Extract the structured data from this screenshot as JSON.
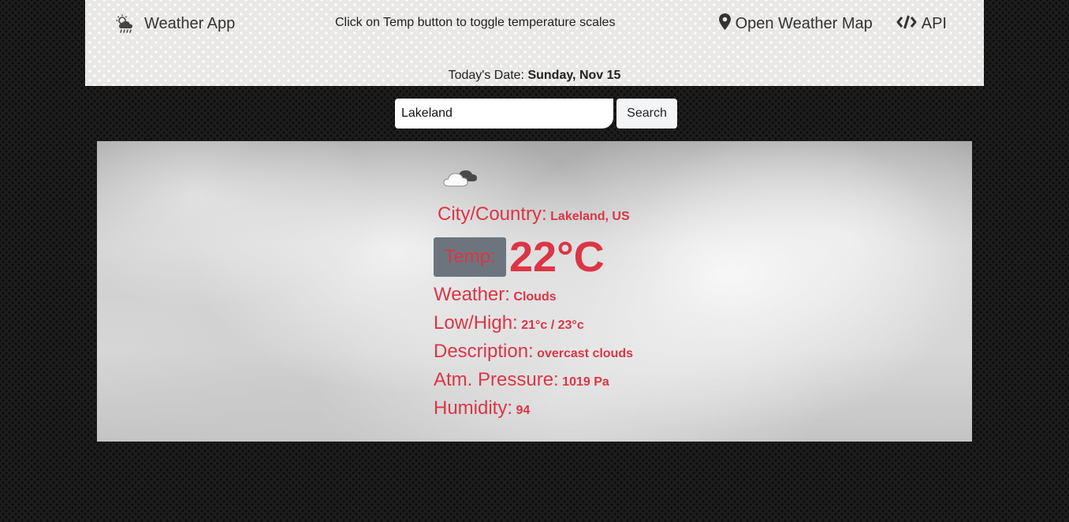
{
  "nav": {
    "brand": "Weather App",
    "brand_icon": "cloud-rain-icon",
    "hint": "Click on Temp button to toggle temperature scales",
    "links": [
      {
        "label": "Open Weather Map",
        "icon": "map-marker-icon"
      },
      {
        "label": "API",
        "icon": "code-icon"
      }
    ],
    "date_label": "Today's Date:",
    "date_value": "Sunday, Nov 15"
  },
  "search": {
    "value": "Lakeland",
    "button": "Search"
  },
  "weather": {
    "icon": "cloud-icon",
    "city_label": "City/Country:",
    "city_value": "Lakeland, US",
    "temp_button": "Temp:",
    "temp_value": "22°C",
    "weather_label": "Weather:",
    "weather_value": "Clouds",
    "lowhigh_label": "Low/High:",
    "lowhigh_value": "21°c / 23°c",
    "desc_label": "Description:",
    "desc_value": "overcast clouds",
    "pressure_label": "Atm. Pressure:",
    "pressure_value": "1019 Pa",
    "humidity_label": "Humidity:",
    "humidity_value": "94"
  },
  "colors": {
    "accent": "#dc3545",
    "temp_button_bg": "#6c757d",
    "navbar_bg": "#e9e8e6"
  }
}
